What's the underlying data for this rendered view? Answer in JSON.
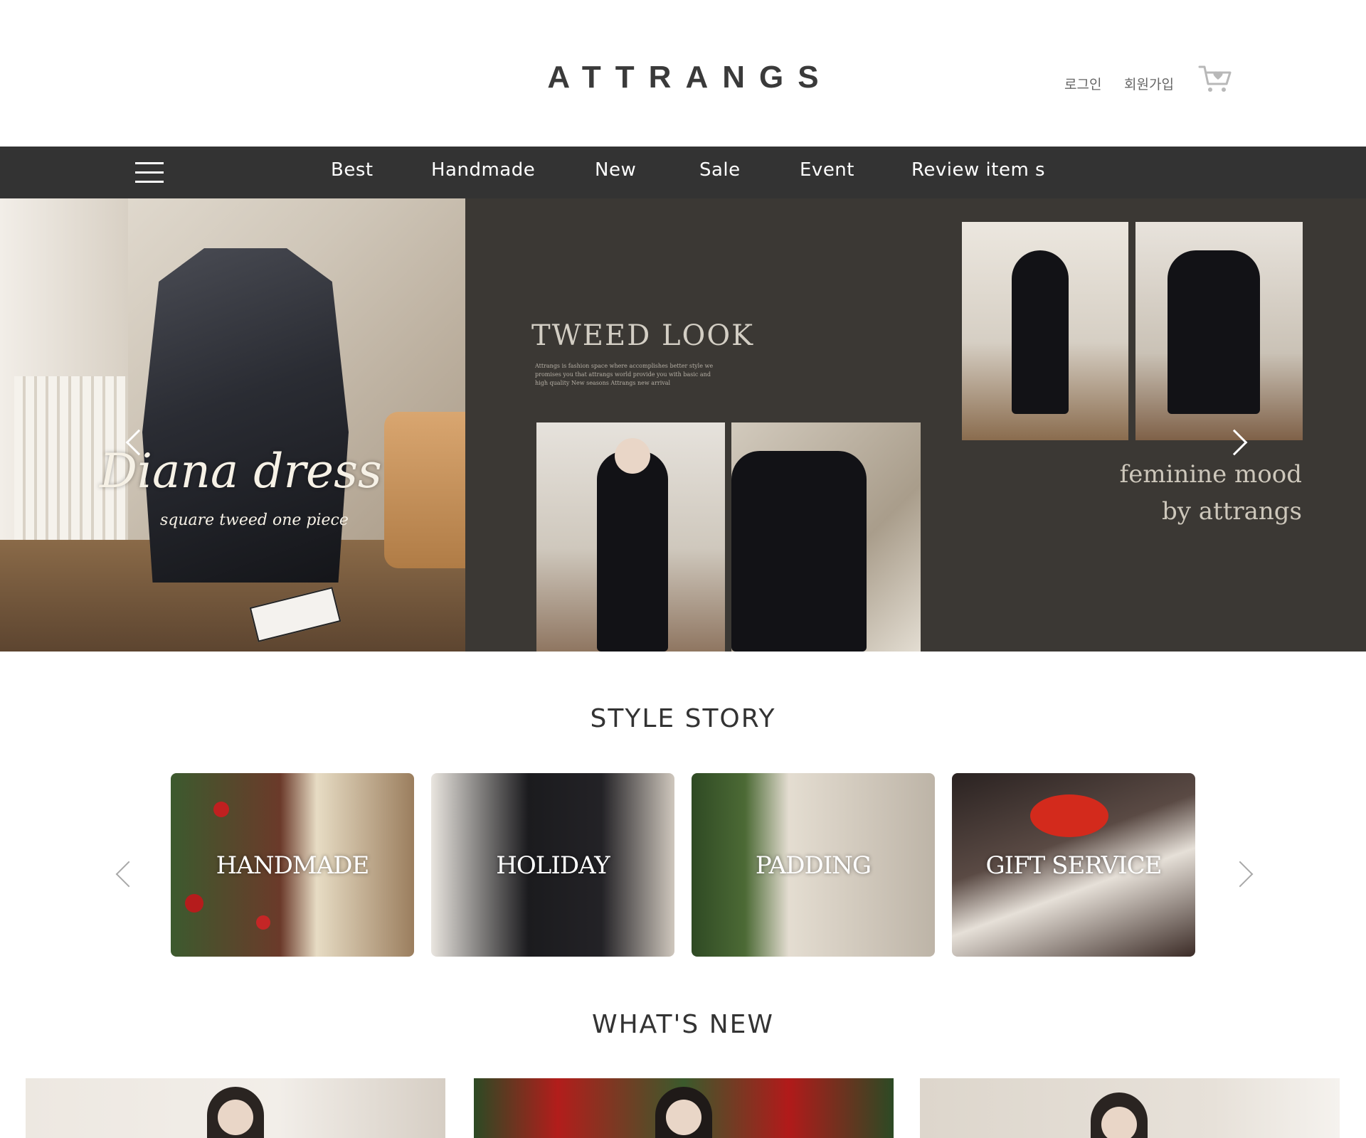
{
  "header": {
    "logo": "ATTRANGS",
    "login": "로그인",
    "join": "회원가입",
    "cart_icon": "cart-heart-icon"
  },
  "nav": {
    "menu_icon": "hamburger-menu-icon",
    "items": [
      "Best",
      "Handmade",
      "New",
      "Sale",
      "Event",
      "Review item s"
    ]
  },
  "hero": {
    "left_title": "Diana dress",
    "left_subtitle": "square tweed one piece",
    "center_title": "TWEED LOOK",
    "center_copy": "Attrangs is fashion space where accomplishes better style we promises you that attrangs world provide you with basic and high quality New seasons Attrangs new arrival",
    "right_text_line1": "feminine mood",
    "right_text_line2": "by attrangs",
    "prev_icon": "chevron-left-icon",
    "next_icon": "chevron-right-icon"
  },
  "style_story": {
    "title": "STYLE STORY",
    "cards": [
      {
        "label": "HANDMADE"
      },
      {
        "label": "HOLIDAY"
      },
      {
        "label": "PADDING"
      },
      {
        "label": "GIFT SERVICE"
      }
    ]
  },
  "whats_new": {
    "title": "WHAT'S NEW"
  },
  "colors": {
    "nav_bg": "#333333",
    "hero_bg": "#3b3834",
    "text": "#333333"
  }
}
